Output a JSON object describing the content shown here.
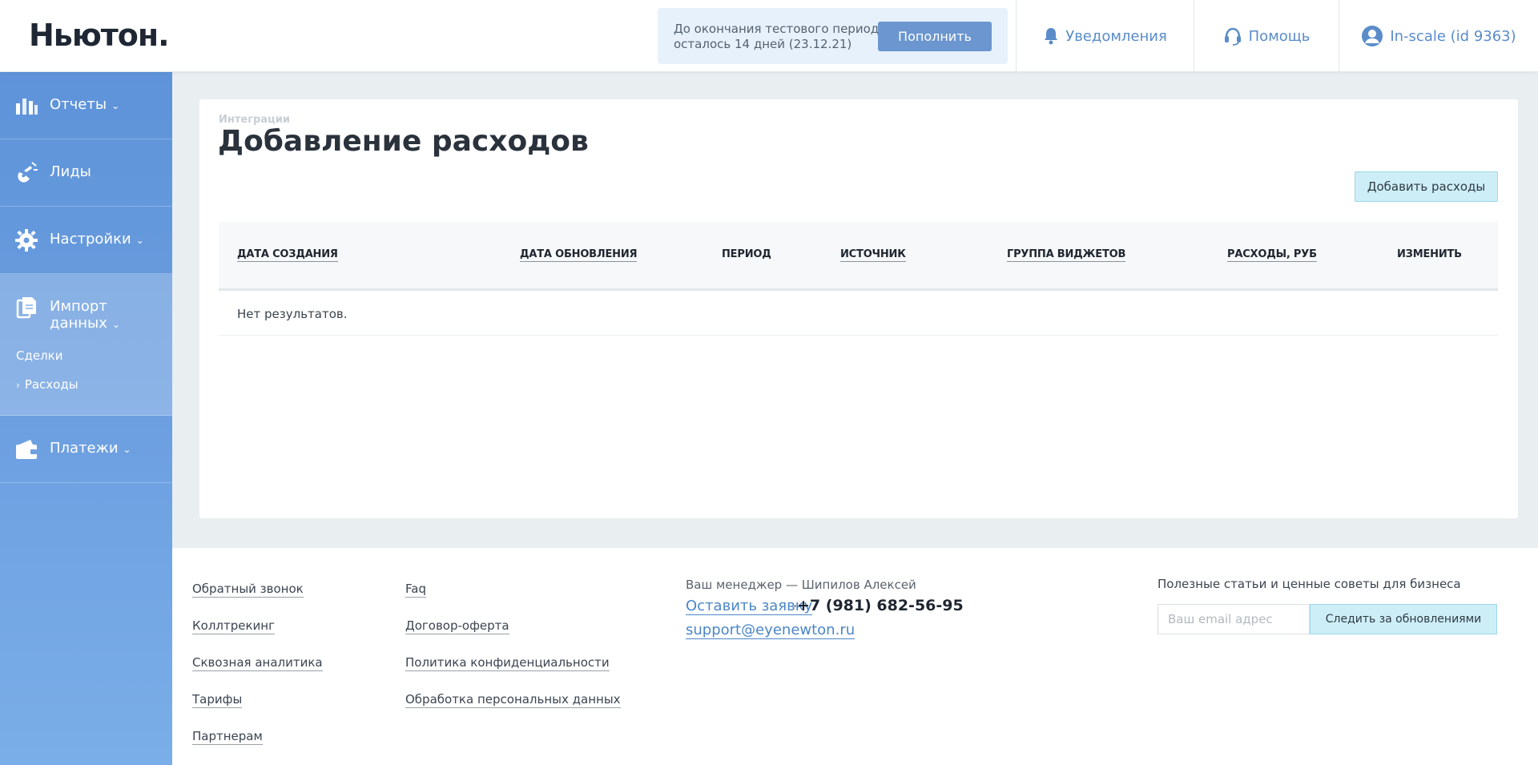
{
  "header": {
    "logo": "Ньютон.",
    "trial_line1": "До окончания тестового периода",
    "trial_line2": "осталось 14 дней (23.12.21)",
    "topup_label": "Пополнить",
    "notifications_label": "Уведомления",
    "help_label": "Помощь",
    "user_label": "In-scale (id 9363)"
  },
  "sidebar": {
    "items": [
      {
        "label": "Отчеты",
        "icon": "bar-chart-icon"
      },
      {
        "label": "Лиды",
        "icon": "magnet-icon"
      },
      {
        "label": "Настройки",
        "icon": "gear-icon"
      },
      {
        "label": "Импорт данных",
        "icon": "documents-icon"
      },
      {
        "label": "Платежи",
        "icon": "wallet-icon"
      }
    ],
    "import_sub": [
      {
        "label": "Сделки"
      },
      {
        "label": "Расходы"
      }
    ]
  },
  "main": {
    "breadcrumb": "Интеграции",
    "title": "Добавление расходов",
    "add_button": "Добавить расходы",
    "columns": [
      "ДАТА СОЗДАНИЯ",
      "ДАТА ОБНОВЛЕНИЯ",
      "ПЕРИОД",
      "ИСТОЧНИК",
      "ГРУППА ВИДЖЕТОВ",
      "РАСХОДЫ, РУБ",
      "ИЗМЕНИТЬ"
    ],
    "empty_text": "Нет результатов."
  },
  "footer": {
    "col1": [
      "Обратный звонок",
      "Коллтрекинг",
      "Сквозная аналитика",
      "Тарифы",
      "Партнерам"
    ],
    "col2": [
      "Faq",
      "Договор-оферта",
      "Политика конфиденциальности",
      "Обработка персональных данных"
    ],
    "manager": "Ваш менеджер — Шипилов Алексей",
    "leave_request": "Оставить заявку",
    "phone": "+7 (981) 682-56-95",
    "email": "support@eyenewton.ru",
    "tips": "Полезные статьи и ценные советы для бизнеса",
    "email_placeholder": "Ваш email адрес",
    "subscribe_label": "Следить за обновлениями"
  }
}
